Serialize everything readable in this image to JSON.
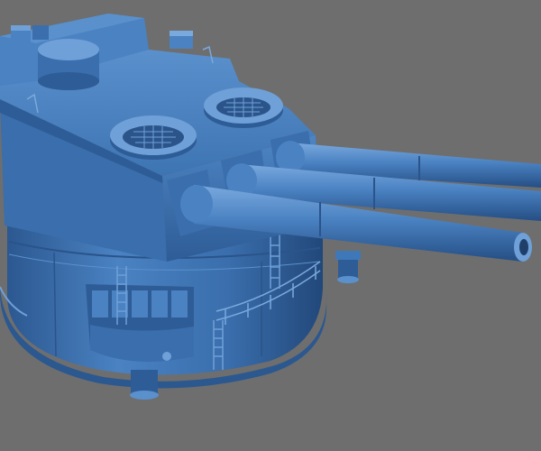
{
  "scene": {
    "background_color": "#6e6e6e",
    "model_color": "#3f78b8",
    "shadow_color": "#24497a",
    "highlight_color": "#6fa0d8",
    "barrel_count": 3,
    "hatch_count": 2,
    "ladder_count": 4
  }
}
